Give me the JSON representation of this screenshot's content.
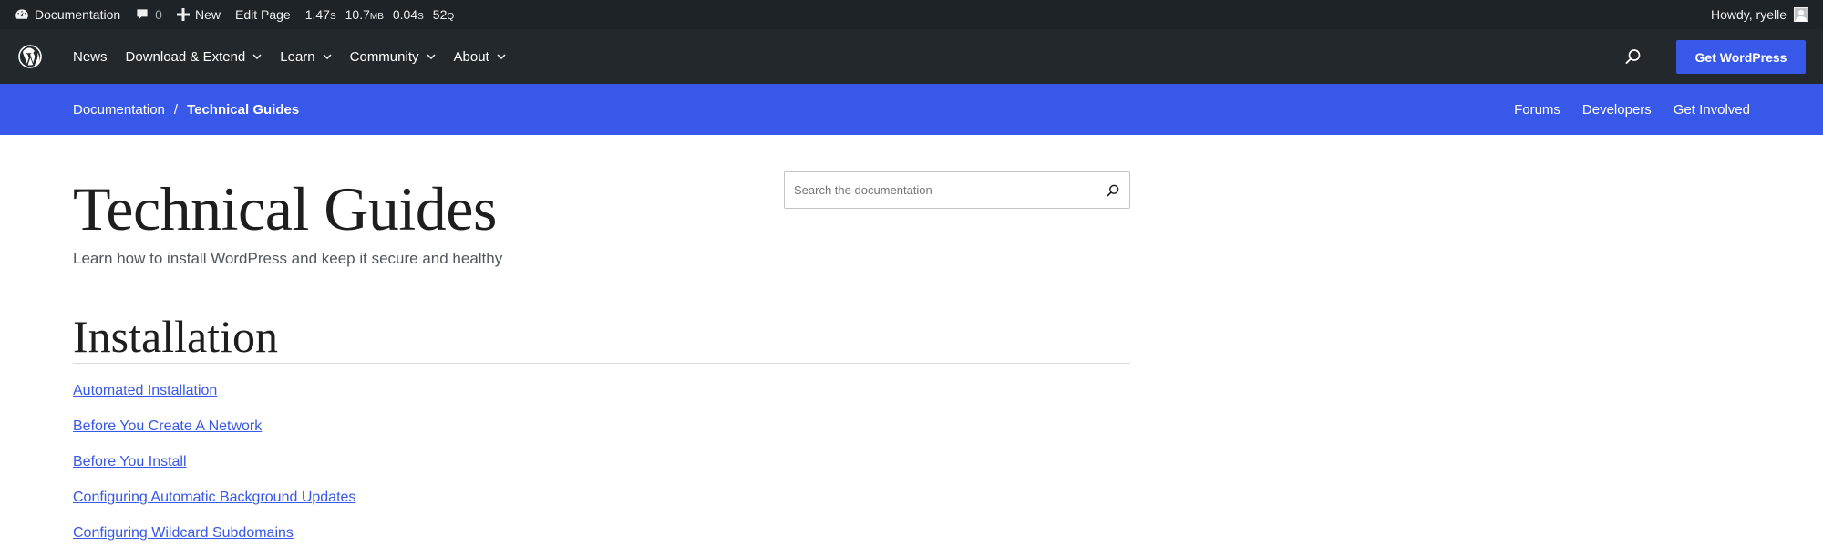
{
  "adminbar": {
    "site_name": "Documentation",
    "comments_count": "0",
    "new_label": "New",
    "edit_label": "Edit Page",
    "stats": {
      "time_value": "1.47",
      "time_unit": "S",
      "memory_value": "10.7",
      "memory_unit": "MB",
      "query_time_value": "0.04",
      "query_time_unit": "S",
      "queries_value": "52",
      "queries_unit": "Q"
    },
    "greeting": "Howdy, ryelle"
  },
  "globalnav": {
    "items": [
      {
        "label": "News",
        "has_dropdown": false
      },
      {
        "label": "Download & Extend",
        "has_dropdown": true
      },
      {
        "label": "Learn",
        "has_dropdown": true
      },
      {
        "label": "Community",
        "has_dropdown": true
      },
      {
        "label": "About",
        "has_dropdown": true
      }
    ],
    "cta_label": "Get WordPress"
  },
  "localnav": {
    "breadcrumb_root": "Documentation",
    "breadcrumb_separator": "/",
    "breadcrumb_current": "Technical Guides",
    "links": [
      "Forums",
      "Developers",
      "Get Involved"
    ]
  },
  "main": {
    "title": "Technical Guides",
    "subtitle": "Learn how to install WordPress and keep it secure and healthy",
    "search_placeholder": "Search the documentation",
    "section_title": "Installation",
    "links": [
      "Automated Installation",
      "Before You Create A Network",
      "Before You Install",
      "Configuring Automatic Background Updates",
      "Configuring Wildcard Subdomains"
    ]
  },
  "colors": {
    "adminbar_bg": "#1d2327",
    "globalnav_bg": "#23282d",
    "accent_blue": "#3858e9",
    "link_color": "#3858e9"
  },
  "icons": [
    "dashboard-icon",
    "comment-icon",
    "plus-icon",
    "wordpress-logo-icon",
    "chevron-down-icon",
    "search-icon",
    "avatar"
  ]
}
